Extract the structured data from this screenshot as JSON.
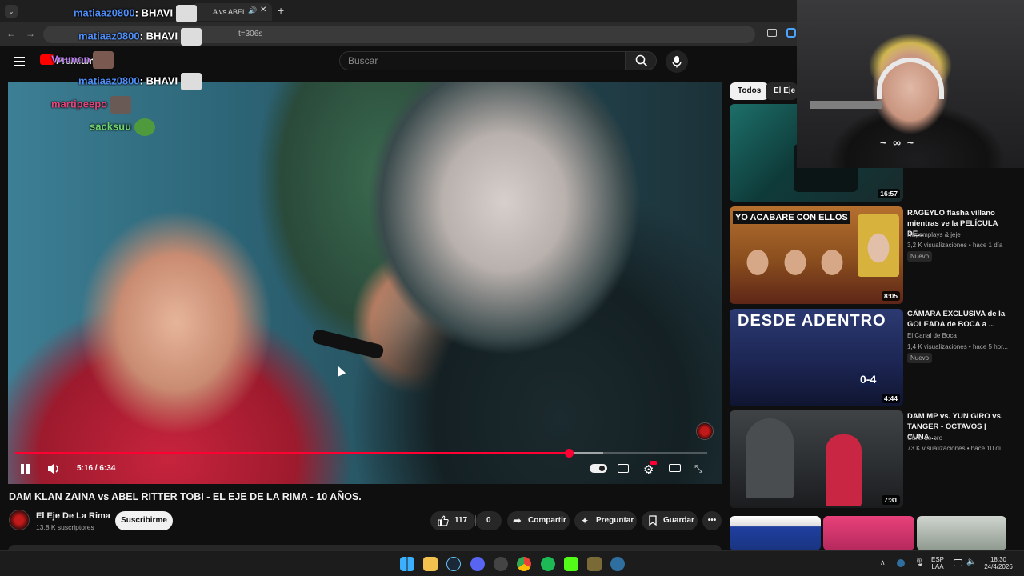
{
  "browser": {
    "tab_title": "A vs ABEL",
    "url": "t=306s"
  },
  "youtube": {
    "premium_label": "Premium",
    "search_placeholder": "Buscar"
  },
  "player": {
    "current_time": "5:16",
    "total_time": "6:34",
    "time_display": "5:16 / 6:34",
    "progress_fraction": 0.8,
    "buffered_fraction": 0.85
  },
  "video": {
    "title": "DAM KLAN ZAINA vs ABEL RITTER TOBI - EL EJE DE LA RIMA - 10 AÑOS.",
    "channel_name": "El Eje De La Rima",
    "subscribers": "13,8 K suscriptores",
    "subscribe_label": "Suscribirme",
    "likes": "117",
    "dislikes": "0",
    "share_label": "Compartir",
    "ask_label": "Preguntar",
    "save_label": "Guardar"
  },
  "sidebar": {
    "chips": [
      "Todos",
      "El Eje D"
    ],
    "items": [
      {
        "title": "",
        "channel": "",
        "meta": "",
        "duration": "16:57",
        "badge": ""
      },
      {
        "title": "RAGEYLO flasha villano mientras ve la PELÍCULA DE...",
        "channel": "Ragemplays & jeje",
        "meta": "3,2 K visualizaciones • hace 1 día",
        "duration": "8:05",
        "badge": "Nuevo",
        "thumb_text": "YO ACABARE CON ELLOS"
      },
      {
        "title": "CÁMARA EXCLUSIVA de la GOLEADA de BOCA a ...",
        "channel": "El Canal de Boca",
        "meta": "1,4 K visualizaciones • hace 5 hor...",
        "duration": "4:44",
        "badge": "Nuevo",
        "thumb_text": "DESDE ADENTRO",
        "thumb_score": "0-4"
      },
      {
        "title": "DAM MP vs. YUN GIRO vs. TANGER - OCTAVOS | CUNA...",
        "channel": "Cuna de oro",
        "meta": "73 K visualizaciones • hace 10 dí...",
        "duration": "7:31",
        "badge": ""
      }
    ]
  },
  "chat": [
    {
      "user": "matiaaz0800",
      "message": "BHAVI",
      "color": "#4f8df7"
    },
    {
      "user": "matiaaz0800",
      "message": "BHAVI",
      "color": "#4f8df7"
    },
    {
      "user": "Vrumon",
      "message": "",
      "color": "#c07cff"
    },
    {
      "user": "matiaaz0800",
      "message": "BHAVI",
      "color": "#4f8df7"
    },
    {
      "user": "martipeepo",
      "message": "",
      "color": "#e0457b"
    },
    {
      "user": "sacksuu",
      "message": "",
      "color": "#6fd36f"
    }
  ],
  "taskbar": {
    "lang_top": "ESP",
    "lang_bottom": "LAA",
    "time": "18:30",
    "date": "24/4/2026"
  },
  "colors": {
    "accent": "#ff0033",
    "background": "#0f0f0f"
  }
}
